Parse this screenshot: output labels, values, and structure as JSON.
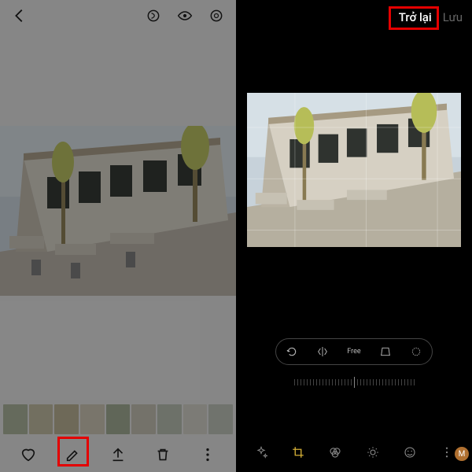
{
  "left": {
    "icons": {
      "back": "back-icon",
      "top": [
        "bixby-vision-icon",
        "eye-icon",
        "circle-icon"
      ],
      "bottom": {
        "favorite": "heart-icon",
        "edit": "edit-icon",
        "share": "share-icon",
        "delete": "trash-icon",
        "more": "more-icon"
      }
    },
    "highlight": "edit-button"
  },
  "right": {
    "back_label": "Trở lại",
    "save_label": "Lưu",
    "highlight": "back-button",
    "transform_tools": [
      "rotate",
      "flip",
      "free",
      "perspective",
      "auto"
    ],
    "bottom_icons": [
      "autofix",
      "crop",
      "filters",
      "brightness",
      "stickers",
      "more"
    ],
    "ruler_value": 0,
    "badge_text": "M"
  },
  "photo_alt": "outdoor patio with white building, tables and trees"
}
